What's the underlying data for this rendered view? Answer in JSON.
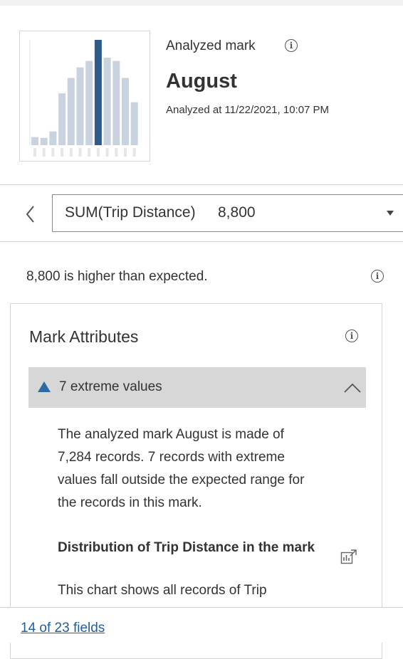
{
  "header": {
    "analyzed_label": "Analyzed mark",
    "mark_name": "August",
    "timestamp": "Analyzed at 11/22/2021, 10:07 PM",
    "thumbnail": {
      "type": "bar",
      "highlight_index": 7,
      "values": [
        10,
        9,
        17,
        64,
        83,
        96,
        104,
        130,
        108,
        104,
        83,
        53
      ],
      "ymax": 130,
      "bar_color": "#c9d3df",
      "highlight_color": "#2f5b8a"
    }
  },
  "measure": {
    "name": "SUM(Trip Distance)",
    "value": "8,800"
  },
  "summary": "8,800 is higher than expected.",
  "card": {
    "title": "Mark Attributes",
    "accordion_label": "7 extreme values",
    "body_lines": [
      "The analyzed mark August is made of",
      "7,284 records. 7 records with extreme",
      "values fall outside the expected range for",
      "the records in this mark."
    ],
    "dist_title": "Distribution of Trip Distance in the mark",
    "dist_desc": "This chart shows all records of Trip"
  },
  "footer": {
    "fields_link": "14 of 23 fields"
  },
  "colors": {
    "accent": "#2c6aa1",
    "link": "#1f5fa0",
    "accordion_bg": "#d7d7d7"
  }
}
